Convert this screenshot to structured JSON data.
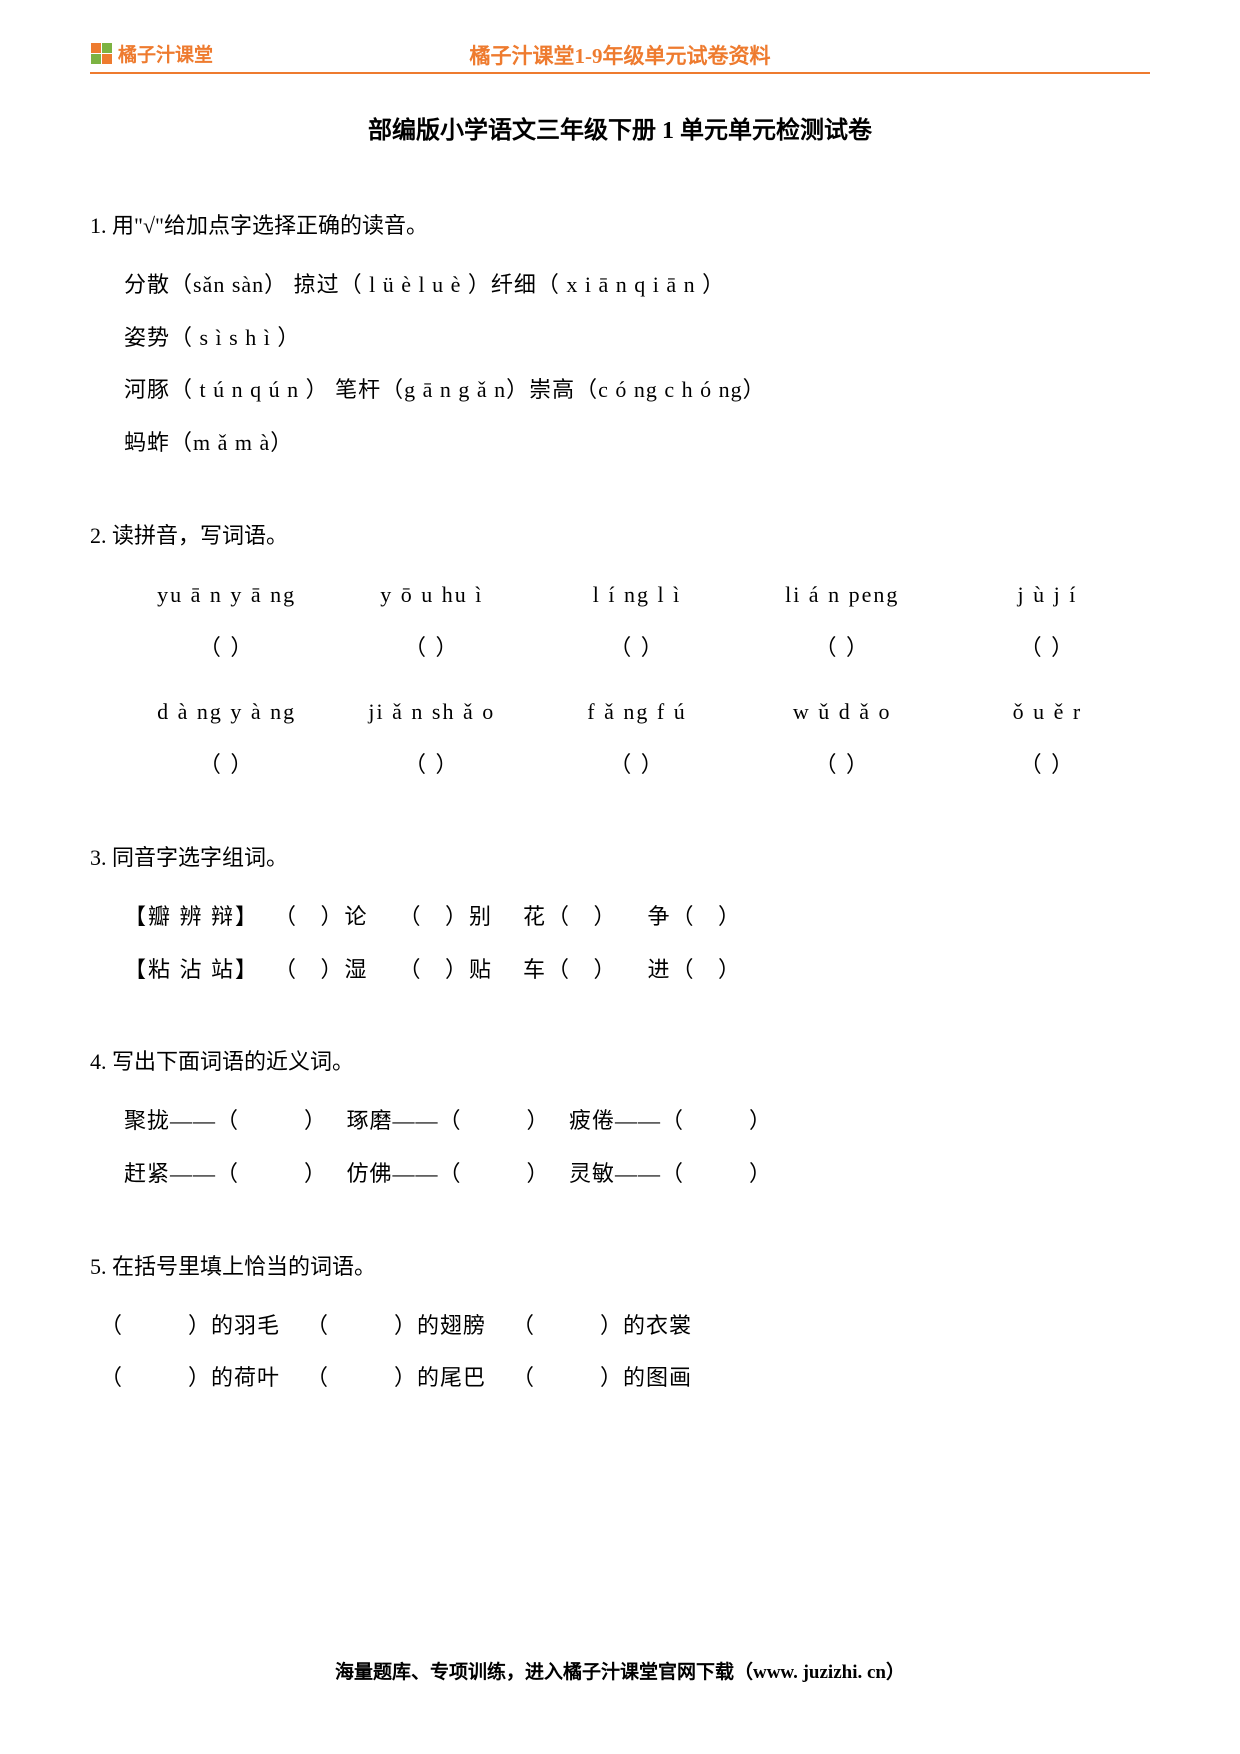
{
  "header": {
    "logo_text": "橘子汁课堂",
    "subtitle": "橘子汁课堂1-9年级单元试卷资料"
  },
  "main_title": "部编版小学语文三年级下册 1 单元单元检测试卷",
  "q1": {
    "title": "1. 用\"√\"给加点字选择正确的读音。",
    "line1": "分散（sǎn sàn）  掠过（ l ü è   l u è ）纤细（ x i ā n  q i ā n ）",
    "line2": "姿势（ s ì   s h ì ）",
    "line3": "河豚（ t ú n   q ú n ）  笔杆（g ā n g ǎ n）崇高（c ó ng c h ó ng）",
    "line4": "蚂蚱（m ǎ  m à）"
  },
  "q2": {
    "title": "2. 读拼音，写词语。",
    "row1": [
      "yu ā n y ā ng",
      "y ō u   hu ì",
      "l í ng l ì",
      "li á n peng",
      "j ù  j í"
    ],
    "row2": [
      "d à ng y à ng",
      "ji ǎ n sh ǎ o",
      "f ǎ ng f ú",
      "w ǔ   d ǎ o",
      "ǒ u  ě r"
    ],
    "bracket": "（          ）"
  },
  "q3": {
    "title": "3. 同音字选字组词。",
    "line1": "【瓣 辨 辩】  （   ）论    （   ）别    花（   ）    争（   ）",
    "line2": "【粘 沾 站】  （   ）湿    （   ）贴    车（   ）    进（   ）"
  },
  "q4": {
    "title": "4. 写出下面词语的近义词。",
    "line1": "聚拢——（          ）   琢磨——（          ）   疲倦——（          ）",
    "line2": "赶紧——（          ）   仿佛——（          ）   灵敏——（          ）"
  },
  "q5": {
    "title": "5. 在括号里填上恰当的词语。",
    "line1": "（          ）的羽毛    （          ）的翅膀    （          ）的衣裳",
    "line2": "（          ）的荷叶    （          ）的尾巴    （          ）的图画"
  },
  "footer": "海量题库、专项训练，进入橘子汁课堂官网下载（www. juzizhi. cn）"
}
